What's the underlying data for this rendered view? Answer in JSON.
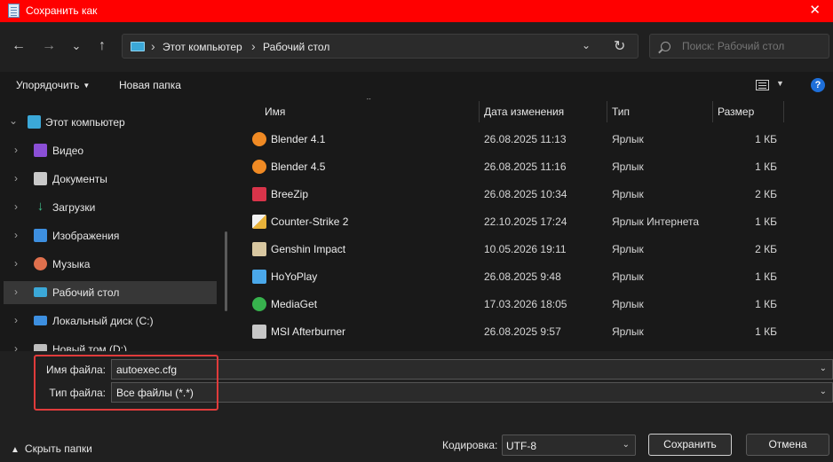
{
  "window": {
    "title": "Сохранить как",
    "close_glyph": "✕"
  },
  "nav": {
    "back": "←",
    "forward": "→",
    "recent": "⌄",
    "up": "↑",
    "breadcrumb": [
      "Этот компьютер",
      "Рабочий стол"
    ],
    "search_placeholder": "Поиск: Рабочий стол"
  },
  "toolbar": {
    "organize": "Упорядочить",
    "new_folder": "Новая папка",
    "help": "?"
  },
  "sidebar": {
    "items": [
      {
        "label": "Этот компьютер",
        "icon": "computer-icon",
        "color": "#3ba8d8"
      },
      {
        "label": "Видео",
        "icon": "video-icon",
        "color": "#8b4fd6"
      },
      {
        "label": "Документы",
        "icon": "documents-icon",
        "color": "#c9c9c9"
      },
      {
        "label": "Загрузки",
        "icon": "downloads-icon",
        "color": "#3fbf8a"
      },
      {
        "label": "Изображения",
        "icon": "images-icon",
        "color": "#3d8fe0"
      },
      {
        "label": "Музыка",
        "icon": "music-icon",
        "color": "#e0704d"
      },
      {
        "label": "Рабочий стол",
        "icon": "desktop-icon",
        "color": "#3ba8d8"
      },
      {
        "label": "Локальный диск (C:)",
        "icon": "drive-c-icon",
        "color": "#3d8fe0"
      },
      {
        "label": "Новый том (D:)",
        "icon": "drive-d-icon",
        "color": "#bdbdbd"
      }
    ]
  },
  "columns": {
    "name": "Имя",
    "date": "Дата изменения",
    "type": "Тип",
    "size": "Размер"
  },
  "files": [
    {
      "name": "Blender 4.1",
      "date": "26.08.2025 11:13",
      "type": "Ярлык",
      "size": "1 КБ",
      "icon": "blender-icon",
      "color": "#f08a24"
    },
    {
      "name": "Blender 4.5",
      "date": "26.08.2025 11:16",
      "type": "Ярлык",
      "size": "1 КБ",
      "icon": "blender-icon",
      "color": "#f08a24"
    },
    {
      "name": "BreeZip",
      "date": "26.08.2025 10:34",
      "type": "Ярлык",
      "size": "2 КБ",
      "icon": "breezip-icon",
      "color": "#d9344a"
    },
    {
      "name": "Counter-Strike 2",
      "date": "22.10.2025 17:24",
      "type": "Ярлык Интернета",
      "size": "1 КБ",
      "icon": "cs2-icon",
      "color": "#e8b23a"
    },
    {
      "name": "Genshin Impact",
      "date": "10.05.2026 19:11",
      "type": "Ярлык",
      "size": "2 КБ",
      "icon": "genshin-icon",
      "color": "#d8c7a0"
    },
    {
      "name": "HoYoPlay",
      "date": "26.08.2025 9:48",
      "type": "Ярлык",
      "size": "1 КБ",
      "icon": "hoyoplay-icon",
      "color": "#4aa8ea"
    },
    {
      "name": "MediaGet",
      "date": "17.03.2026 18:05",
      "type": "Ярлык",
      "size": "1 КБ",
      "icon": "mediaget-icon",
      "color": "#37b24d"
    },
    {
      "name": "MSI Afterburner",
      "date": "26.08.2025 9:57",
      "type": "Ярлык",
      "size": "1 КБ",
      "icon": "msi-afterburner-icon",
      "color": "#c7c7c7"
    }
  ],
  "form": {
    "filename_label": "Имя файла:",
    "filename_value": "autoexec.cfg",
    "filetype_label": "Тип файла:",
    "filetype_value": "Все файлы (*.*)",
    "hide_folders": "Скрыть папки",
    "encoding_label": "Кодировка:",
    "encoding_value": "UTF-8",
    "save": "Сохранить",
    "cancel": "Отмена"
  },
  "colors": {
    "titlebar": "#ff0000",
    "highlight": "#e03b3b",
    "background": "#191919"
  }
}
